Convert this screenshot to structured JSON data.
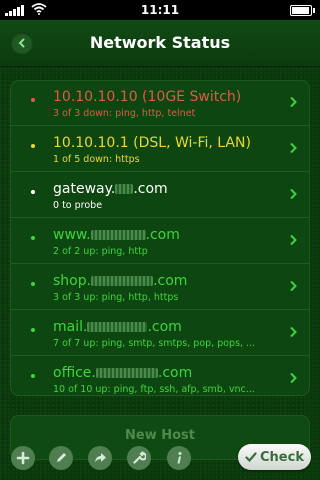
{
  "status_bar": {
    "time": "11:11"
  },
  "nav": {
    "title": "Network Status"
  },
  "hosts": [
    {
      "name": "10.10.10.10 (10GE Switch)",
      "status": "3 of 3 down: ping, http, telnet",
      "status_color": "#e05a45"
    },
    {
      "name": "10.10.10.1 (DSL, Wi-Fi, LAN)",
      "status": "1 of 5 down: https",
      "status_color": "#e8d830"
    },
    {
      "name_prefix": "gateway.",
      "name_suffix": ".com",
      "status": "0 to probe",
      "status_color": "#ffffff"
    },
    {
      "name_prefix": "www.",
      "name_suffix": ".com",
      "status": "2 of 2 up: ping, http",
      "status_color": "#3fd43f"
    },
    {
      "name_prefix": "shop.",
      "name_suffix": ".com",
      "status": "3 of 3 up: ping, http, https",
      "status_color": "#3fd43f"
    },
    {
      "name_prefix": "mail.",
      "name_suffix": ".com",
      "status": "7 of 7 up: ping, smtp, smtps, pop, pops, ...",
      "status_color": "#3fd43f"
    },
    {
      "name_prefix": "office.",
      "name_suffix": ".com",
      "status": "10 of 10 up: ping, ftp, ssh, afp, smb, vnc...",
      "status_color": "#3fd43f"
    }
  ],
  "new_host": {
    "label": "New Host"
  },
  "toolbar": {
    "icons": [
      "plus-icon",
      "pencil-icon",
      "share-arrow-icon",
      "wrench-icon",
      "info-icon"
    ],
    "check_label": "Check"
  },
  "colors": {
    "background": "#0a3a0c",
    "accent": "#3fd43f",
    "down": "#e05a45",
    "warning": "#e8d830"
  }
}
